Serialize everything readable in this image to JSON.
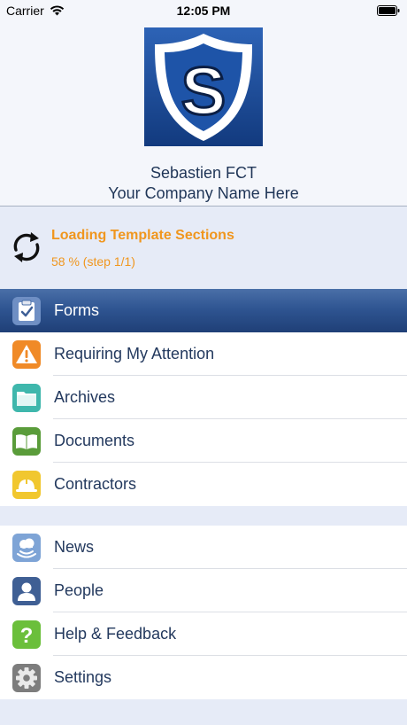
{
  "status_bar": {
    "carrier": "Carrier",
    "time": "12:05 PM"
  },
  "header": {
    "user_name": "Sebastien FCT",
    "company_name": "Your Company Name Here",
    "logo_letter": "S"
  },
  "loading": {
    "title": "Loading Template Sections",
    "progress_text": "58 % (step 1/1)",
    "progress_percent": 58
  },
  "menu": {
    "section1": [
      {
        "label": "Forms",
        "icon": "clipboard-check-icon",
        "selected": true
      },
      {
        "label": "Requiring My Attention",
        "icon": "warning-icon",
        "selected": false
      },
      {
        "label": "Archives",
        "icon": "folder-icon",
        "selected": false
      },
      {
        "label": "Documents",
        "icon": "book-icon",
        "selected": false
      },
      {
        "label": "Contractors",
        "icon": "hard-hat-icon",
        "selected": false
      }
    ],
    "section2": [
      {
        "label": "News",
        "icon": "news-broadcast-icon",
        "selected": false
      },
      {
        "label": "People",
        "icon": "person-icon",
        "selected": false
      },
      {
        "label": "Help & Feedback",
        "icon": "question-icon",
        "selected": false
      },
      {
        "label": "Settings",
        "icon": "gear-icon",
        "selected": false
      }
    ]
  },
  "colors": {
    "accent_orange": "#f0961e",
    "selected_row": "#2f5592",
    "text_navy": "#23395e",
    "section_bg": "#e6ebf7"
  }
}
